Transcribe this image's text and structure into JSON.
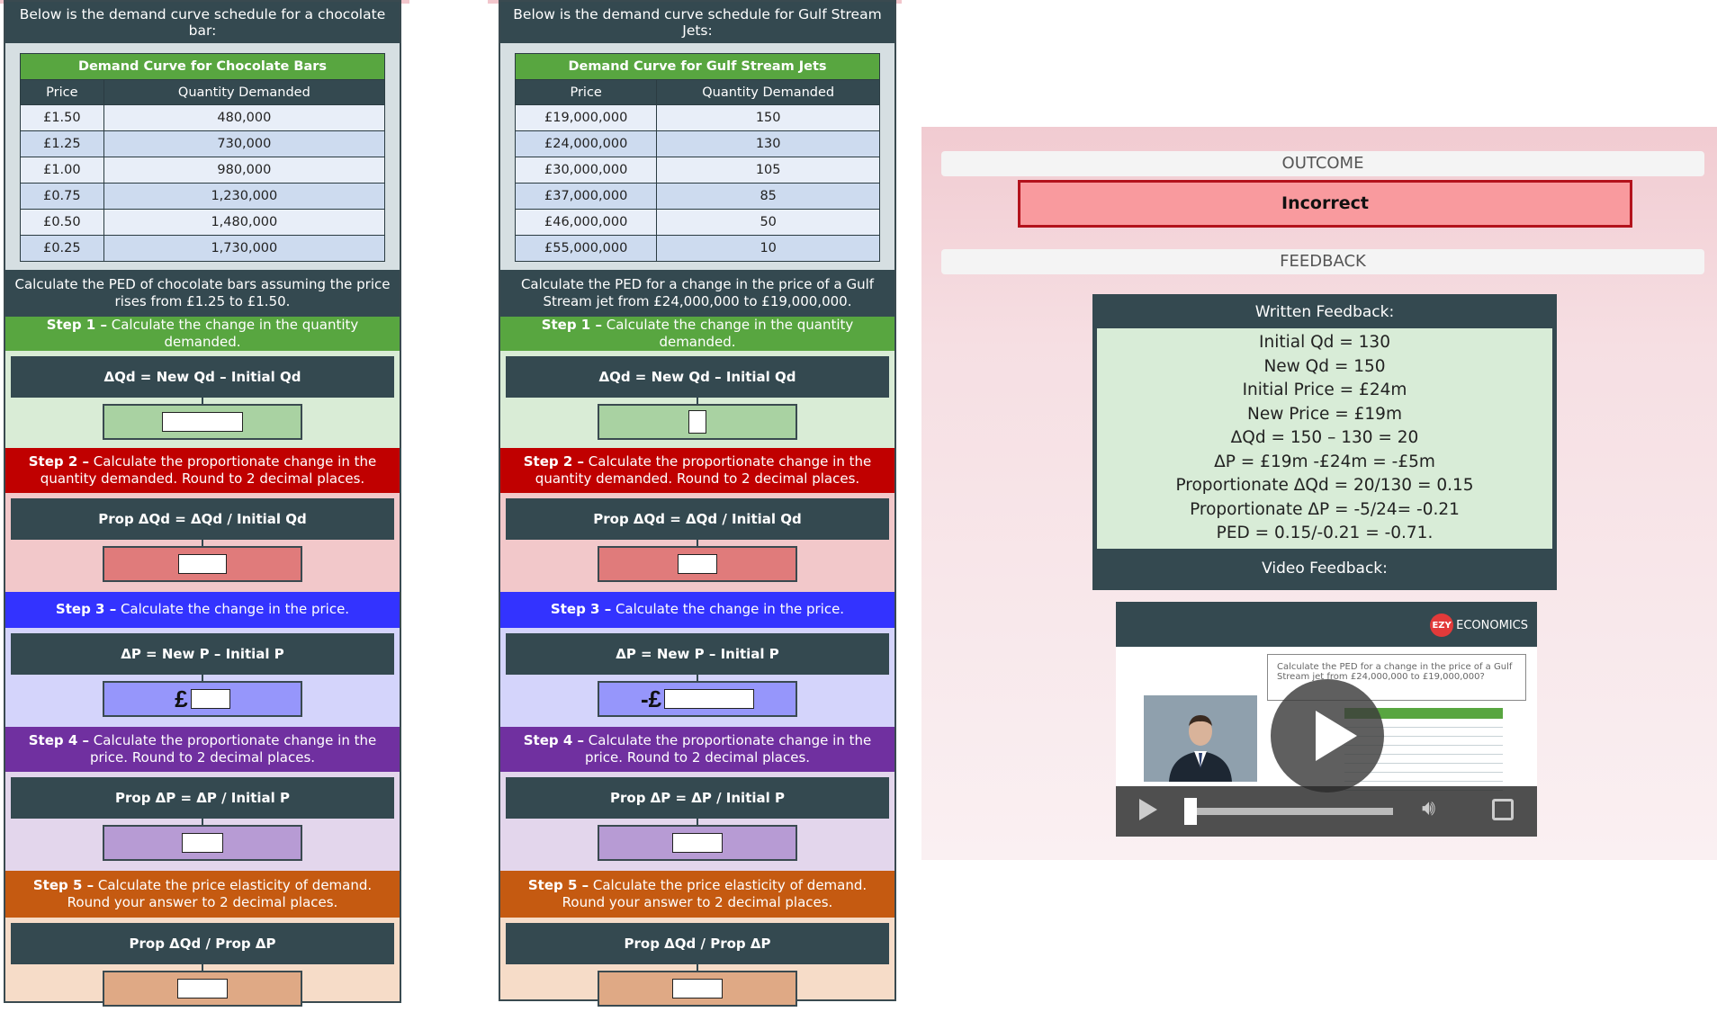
{
  "left": {
    "intro": "Below is the demand curve schedule for a chocolate bar:",
    "table_title": "Demand Curve for Chocolate Bars",
    "col_price": "Price",
    "col_qty": "Quantity Demanded",
    "rows": [
      [
        "£1.50",
        "480,000"
      ],
      [
        "£1.25",
        "730,000"
      ],
      [
        "£1.00",
        "980,000"
      ],
      [
        "£0.75",
        "1,230,000"
      ],
      [
        "£0.50",
        "1,480,000"
      ],
      [
        "£0.25",
        "1,730,000"
      ]
    ],
    "question": "Calculate the PED of chocolate bars assuming the price rises from £1.25 to £1.50.",
    "currency_prefix": "£"
  },
  "right": {
    "intro": "Below is the demand curve schedule for Gulf Stream Jets:",
    "table_title": "Demand Curve for Gulf Stream Jets",
    "col_price": "Price",
    "col_qty": "Quantity Demanded",
    "rows": [
      [
        "£19,000,000",
        "150"
      ],
      [
        "£24,000,000",
        "130"
      ],
      [
        "£30,000,000",
        "105"
      ],
      [
        "£37,000,000",
        "85"
      ],
      [
        "£46,000,000",
        "50"
      ],
      [
        "£55,000,000",
        "10"
      ]
    ],
    "question": "Calculate the PED for a change in the price of a Gulf Stream jet from £24,000,000 to £19,000,000.",
    "currency_prefix": "-£"
  },
  "steps": {
    "s1_label": "Step 1 –",
    "s1_text": " Calculate the change in the quantity demanded.",
    "s1_formula": "ΔQd = New Qd – Initial Qd",
    "s2_label": "Step 2 –",
    "s2_text": " Calculate the proportionate change in the quantity demanded. Round to 2 decimal places.",
    "s2_formula": "Prop ΔQd = ΔQd / Initial Qd",
    "s3_label": "Step 3 –",
    "s3_text": " Calculate the change in the price.",
    "s3_formula": "ΔP = New P – Initial P",
    "s4_label": "Step 4 –",
    "s4_text": " Calculate the proportionate change in the price. Round to 2 decimal places.",
    "s4_formula": "Prop ΔP = ΔP / Initial P",
    "s5_label": "Step 5 –",
    "s5_text": " Calculate the price elasticity of demand. Round your answer to 2 decimal places.",
    "s5_formula": "Prop ΔQd / Prop ΔP"
  },
  "result": {
    "outcome_heading": "OUTCOME",
    "outcome": "Incorrect",
    "feedback_heading": "FEEDBACK",
    "written_title": "Written Feedback:",
    "lines": [
      "Initial Qd = 130",
      "New Qd = 150",
      "Initial Price = £24m",
      "New Price = £19m",
      "ΔQd = 150 – 130 = 20",
      "ΔP = £19m -£24m = -£5m",
      "Proportionate ΔQd = 20/130 = 0.15",
      "Proportionate ΔP = -5/24= -0.21",
      "PED = 0.15/-0.21 = -0.71."
    ],
    "video_title": "Video Feedback:",
    "brand_logo": "EZY",
    "brand_text": "ECONOMICS",
    "video_question": "Calculate the PED for a change in the price of a Gulf Stream jet from £24,000,000 to £19,000,000?"
  },
  "colors": {
    "dark": "#344950",
    "green": "#58a640",
    "red": "#c00000",
    "blue": "#3333ff",
    "purple": "#7030a0",
    "orange": "#c55a11",
    "incorrect_fill": "#f99a9e",
    "incorrect_border": "#b3121c"
  }
}
